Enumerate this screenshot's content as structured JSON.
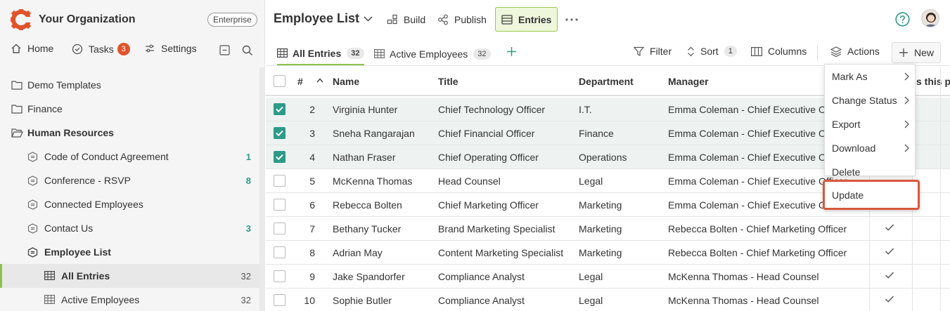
{
  "org": {
    "name": "Your Organization",
    "plan_badge": "Enterprise"
  },
  "nav": {
    "home": "Home",
    "tasks": "Tasks",
    "tasks_count": "3",
    "settings": "Settings"
  },
  "tree": [
    {
      "label": "Demo Templates",
      "count": ""
    },
    {
      "label": "Finance",
      "count": ""
    },
    {
      "label": "Human Resources",
      "count": ""
    },
    {
      "label": "Code of Conduct Agreement",
      "count": "1"
    },
    {
      "label": "Conference - RSVP",
      "count": "8"
    },
    {
      "label": "Connected Employees",
      "count": ""
    },
    {
      "label": "Contact Us",
      "count": "3"
    },
    {
      "label": "Employee List",
      "count": ""
    },
    {
      "label": "All Entries",
      "count": "32"
    },
    {
      "label": "Active Employees",
      "count": "32"
    }
  ],
  "header": {
    "title": "Employee List",
    "build": "Build",
    "publish": "Publish",
    "entries": "Entries"
  },
  "tabs": [
    {
      "label": "All Entries",
      "count": "32"
    },
    {
      "label": "Active Employees",
      "count": "32"
    }
  ],
  "toolbar": {
    "filter": "Filter",
    "sort": "Sort",
    "sort_count": "1",
    "columns": "Columns",
    "actions": "Actions",
    "new": "New"
  },
  "table": {
    "headers": {
      "num": "#",
      "name": "Name",
      "title": "Title",
      "department": "Department",
      "manager": "Manager",
      "extra": "s this p"
    },
    "rows": [
      {
        "num": "2",
        "name": "Virginia Hunter",
        "title": "Chief Technology Officer",
        "department": "I.T.",
        "manager": "Emma Coleman - Chief Executive Officer",
        "selected": true,
        "flag": false
      },
      {
        "num": "3",
        "name": "Sneha Rangarajan",
        "title": "Chief Financial Officer",
        "department": "Finance",
        "manager": "Emma Coleman - Chief Executive Officer",
        "selected": true,
        "flag": false
      },
      {
        "num": "4",
        "name": "Nathan Fraser",
        "title": "Chief Operating Officer",
        "department": "Operations",
        "manager": "Emma Coleman - Chief Executive Officer",
        "selected": true,
        "flag": false
      },
      {
        "num": "5",
        "name": "McKenna Thomas",
        "title": "Head Counsel",
        "department": "Legal",
        "manager": "Emma Coleman - Chief Executive Officer",
        "selected": false,
        "flag": false
      },
      {
        "num": "6",
        "name": "Rebecca Bolten",
        "title": "Chief Marketing Officer",
        "department": "Marketing",
        "manager": "Emma Coleman - Chief Executive Officer",
        "selected": false,
        "flag": false
      },
      {
        "num": "7",
        "name": "Bethany Tucker",
        "title": "Brand Marketing Specialist",
        "department": "Marketing",
        "manager": "Rebecca Bolten - Chief Marketing Officer",
        "selected": false,
        "flag": true
      },
      {
        "num": "8",
        "name": "Adrian May",
        "title": "Content Marketing Specialist",
        "department": "Marketing",
        "manager": "Rebecca Bolten - Chief Marketing Officer",
        "selected": false,
        "flag": true
      },
      {
        "num": "9",
        "name": "Jake Spandorfer",
        "title": "Compliance Analyst",
        "department": "Legal",
        "manager": "McKenna Thomas - Head Counsel",
        "selected": false,
        "flag": true
      },
      {
        "num": "10",
        "name": "Sophie Butler",
        "title": "Compliance Analyst",
        "department": "Legal",
        "manager": "McKenna Thomas - Head Counsel",
        "selected": false,
        "flag": true
      }
    ]
  },
  "actions_menu": {
    "mark_as": "Mark As",
    "change_status": "Change Status",
    "export": "Export",
    "download": "Download",
    "delete": "Delete",
    "update": "Update"
  },
  "colors": {
    "accent": "#8bc34a",
    "teal": "#2d9b87",
    "brand": "#e0542b",
    "highlight": "#d9573b"
  }
}
